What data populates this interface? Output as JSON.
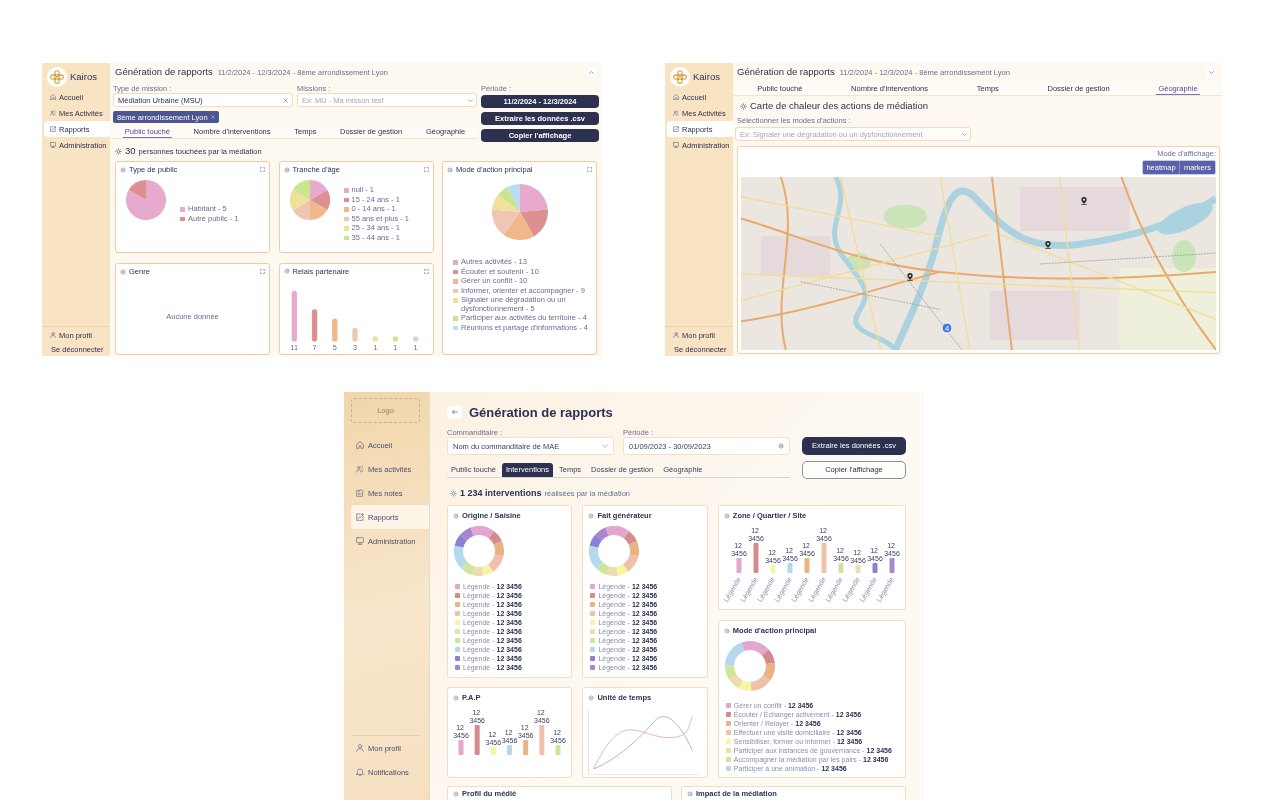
{
  "report_public": {
    "sidebar": {
      "brand": "Kairos",
      "items": [
        {
          "label": "Accueil",
          "selected": false
        },
        {
          "label": "Mes Activités",
          "selected": false
        },
        {
          "label": "Rapports",
          "selected": true
        },
        {
          "label": "Administration",
          "selected": false
        }
      ],
      "footer": [
        "Mon profil",
        "Se déconnecter"
      ]
    },
    "header": {
      "title": "Génération de rapports",
      "subtitle": "11/2/2024 - 12/3/2024 - 8ème arrondissement Lyon",
      "expanded": true
    },
    "filters": {
      "mission_type": {
        "label": "Type de mission :",
        "value": "Médiation Urbaine (MSU)"
      },
      "missions": {
        "label": "Missions :",
        "placeholder": "Ex: MU - Ma misson test"
      },
      "chips": [
        "8ème arrondissement Lyon"
      ],
      "period": {
        "label": "Période :",
        "value": "11/2/2024 - 12/3/2024"
      },
      "buttons": [
        "Extraire les données .csv",
        "Copier l'affichage"
      ]
    },
    "tabs": [
      {
        "label": "Public touché",
        "selected": true
      },
      {
        "label": "Nombre d'interventions",
        "selected": false
      },
      {
        "label": "Temps",
        "selected": false
      },
      {
        "label": "Dossier de gestion",
        "selected": false
      },
      {
        "label": "Géographie",
        "selected": false
      }
    ],
    "summary": {
      "count": "30",
      "text": "personnes touchées par la médiation"
    },
    "cards": [
      {
        "kind": "pie",
        "title": "Type de public",
        "chart_data": {
          "type": "pie",
          "categories": [
            "Habitant - 5",
            "Autre public - 1"
          ],
          "values": [
            83.33,
            16.67
          ],
          "legend": "right",
          "colors": [
            "#e8a9cf",
            "#dc9090"
          ]
        }
      },
      {
        "kind": "pie",
        "title": "Tranche d'âge",
        "chart_data": {
          "type": "pie",
          "categories": [
            "null - 1",
            "15 - 24 ans - 1",
            "0 - 14 ans - 1",
            "55 ans et plus - 1",
            "25 - 34 ans - 1",
            "35 - 44 ans - 1"
          ],
          "values": [
            16.67,
            16.67,
            16.67,
            16.67,
            16.66,
            16.66
          ],
          "legend": "right",
          "colors": [
            "#e8a9cf",
            "#dc9090",
            "#eeb88a",
            "#efc6b6",
            "#efe09a",
            "#cbe48e"
          ]
        }
      },
      {
        "kind": "pie_tall",
        "title": "Mode d'action principal",
        "chart_data": {
          "type": "pie",
          "categories": [
            "Autres activités - 13",
            "Écouter et soutenir - 10",
            "Gérer un conflit - 10",
            "Informer, orienter et accompagner - 9",
            "Signaler une dégradation ou un dysfonctionnement - 5",
            "Participer aux activités du territoire - 4",
            "Réunions et partage d'informations - 4"
          ],
          "values": [
            23.64,
            18.19,
            18.18,
            16.36,
            9.09,
            7.27,
            7.27
          ],
          "legend": "bottom",
          "colors": [
            "#e8a9cf",
            "#dc9090",
            "#eeb88a",
            "#efc6b6",
            "#efe09a",
            "#cbe48e",
            "#b9dcf0"
          ]
        }
      },
      {
        "kind": "empty",
        "title": "Genre",
        "empty_text": "Aucune donnée"
      },
      {
        "kind": "bar",
        "title": "Relais partenaire",
        "chart_data": {
          "type": "bar",
          "values": [
            11,
            7,
            5,
            3,
            1,
            1,
            1
          ],
          "data_labels": true,
          "colors": [
            "#e8a9cf",
            "#dc9090",
            "#eeb88a",
            "#efc6b6",
            "#efe09a",
            "#cbe48e",
            "#b9dcf0"
          ]
        }
      }
    ]
  },
  "report_geography": {
    "sidebar": {
      "brand": "Kairos",
      "items": [
        {
          "label": "Accueil",
          "selected": false
        },
        {
          "label": "Mes Activités",
          "selected": false
        },
        {
          "label": "Rapports",
          "selected": true
        },
        {
          "label": "Administration",
          "selected": false
        }
      ],
      "footer": [
        "Mon profil",
        "Se déconnecter"
      ]
    },
    "header": {
      "title": "Génération de rapports",
      "subtitle": "11/2/2024 - 12/3/2024 - 8ème arrondissement Lyon",
      "expanded": false
    },
    "tabs": [
      {
        "label": "Public touché",
        "selected": false
      },
      {
        "label": "Nombre d'interventions",
        "selected": false
      },
      {
        "label": "Temps",
        "selected": false
      },
      {
        "label": "Dossier de gestion",
        "selected": false
      },
      {
        "label": "Géographie",
        "selected": true
      }
    ],
    "section_title": "Carte de chaleur des actions de médiation",
    "action_filter": {
      "label": "Sélectionner les modes d'actions :",
      "placeholder": "Ex: Signaler une dégradation ou un dysfonctionnement"
    },
    "map": {
      "display_label": "Mode d'affichage:",
      "modes": [
        "heatmap",
        "markers"
      ],
      "markers": [
        {
          "kind": "pin"
        },
        {
          "kind": "pin"
        },
        {
          "kind": "pin"
        },
        {
          "kind": "cluster",
          "count": "4"
        }
      ]
    }
  },
  "report_mockup": {
    "sidebar": {
      "logo_placeholder": "Logo",
      "items": [
        {
          "label": "Accueil",
          "selected": false
        },
        {
          "label": "Mes activités",
          "selected": false
        },
        {
          "label": "Mes notes",
          "selected": false
        },
        {
          "label": "Rapports",
          "selected": true
        },
        {
          "label": "Administration",
          "selected": false
        }
      ],
      "footer": [
        "Mon profil",
        "Notifications"
      ]
    },
    "header": {
      "title": "Génération de rapports"
    },
    "filters": {
      "sponsor": {
        "label": "Commanditaire :",
        "value": "Nom du commanditaire de MAE"
      },
      "period": {
        "label": "Période :",
        "value": "01/09/2023 - 30/09/2023"
      },
      "buttons": [
        {
          "kind": "primary",
          "label": "Extraire les données .csv"
        },
        {
          "kind": "outline",
          "label": "Copier l'affichage"
        }
      ]
    },
    "tabs": [
      {
        "label": "Public touché",
        "selected": false
      },
      {
        "label": "Interventions",
        "selected": true
      },
      {
        "label": "Temps",
        "selected": false
      },
      {
        "label": "Dossier de gestion",
        "selected": false
      },
      {
        "label": "Géographie",
        "selected": false
      }
    ],
    "summary": {
      "count": "1 234 interventions",
      "text": "réalisées par la médiation"
    },
    "card_columns": [
      [
        {
          "kind": "donut",
          "title": "Origine / Saisine",
          "legend": [
            {
              "label": "Légende - **12 3456**",
              "color": "#e2a6cf"
            },
            {
              "label": "Légende - **12 3456**",
              "color": "#d38b8b"
            },
            {
              "label": "Légende - **12 3456**",
              "color": "#e9b383"
            },
            {
              "label": "Légende - **12 3456**",
              "color": "#efc1aa"
            },
            {
              "label": "Légende - **12 3456**",
              "color": "#f8f5a2"
            },
            {
              "label": "Légende - **12 3456**",
              "color": "#ecdcae"
            },
            {
              "label": "Légende - **12 3456**",
              "color": "#cfe59c"
            },
            {
              "label": "Légende - **12 3456**",
              "color": "#b4d9ee"
            },
            {
              "label": "Légende - **12 3456**",
              "color": "#8b80d8"
            },
            {
              "label": "Légende - **12 3456**",
              "color": "#a985d2"
            }
          ]
        },
        {
          "kind": "bar",
          "title": "P.A.P",
          "bars": [
            {
              "label": "12 3456",
              "color": "#e2a6cf"
            },
            {
              "label": "12 3456",
              "color": "#d38b8b"
            },
            {
              "label": "12 3456",
              "color": "#f8f5a2"
            },
            {
              "label": "12 3456",
              "color": "#b4d9ee"
            },
            {
              "label": "12 3456",
              "color": "#e9b383"
            },
            {
              "label": "12 3456",
              "color": "#efc1aa"
            },
            {
              "label": "12 3456",
              "color": "#cfe59c"
            }
          ]
        }
      ],
      [
        {
          "kind": "donut",
          "title": "Fait générateur",
          "legend": [
            {
              "label": "Légende - **12 3456**",
              "color": "#e2a6cf"
            },
            {
              "label": "Légende - **12 3456**",
              "color": "#d38b8b"
            },
            {
              "label": "Légende - **12 3456**",
              "color": "#e9b383"
            },
            {
              "label": "Légende - **12 3456**",
              "color": "#efc1aa"
            },
            {
              "label": "Légende - **12 3456**",
              "color": "#f8f5a2"
            },
            {
              "label": "Légende - **12 3456**",
              "color": "#ecdcae"
            },
            {
              "label": "Légende - **12 3456**",
              "color": "#cfe59c"
            },
            {
              "label": "Légende - **12 3456**",
              "color": "#b4d9ee"
            },
            {
              "label": "Légende - **12 3456**",
              "color": "#8b80d8"
            },
            {
              "label": "Légende - **12 3456**",
              "color": "#a985d2"
            }
          ]
        },
        {
          "kind": "line",
          "title": "Unité de temps"
        }
      ],
      [
        {
          "kind": "bar",
          "title": "Zone / Quartier / Site",
          "bars": [
            {
              "label": "12 3456",
              "category": "Légende",
              "color": "#e2a6cf"
            },
            {
              "label": "12 3456",
              "category": "Légende",
              "color": "#d38b8b"
            },
            {
              "label": "12 3456",
              "category": "Légende",
              "color": "#f8f5a2"
            },
            {
              "label": "12 3456",
              "category": "Légende",
              "color": "#b4d9ee"
            },
            {
              "label": "12 3456",
              "category": "Légende",
              "color": "#e9b383"
            },
            {
              "label": "12 3456",
              "category": "Légende",
              "color": "#efc1aa"
            },
            {
              "label": "12 3456",
              "category": "Légende",
              "color": "#cfe59c"
            },
            {
              "label": "12 3456",
              "category": "Légende",
              "color": "#ecdcae"
            },
            {
              "label": "12 3456",
              "category": "Légende",
              "color": "#8b80d8"
            },
            {
              "label": "12 3456",
              "category": "Légende",
              "color": "#a985d2"
            }
          ]
        },
        {
          "kind": "donut",
          "title": "Mode d'action principal",
          "legend": [
            {
              "label": "Gérer un conflit - **12 3456**",
              "color": "#e2a6cf"
            },
            {
              "label": "Écouter / Échanger activement - **12 3456**",
              "color": "#d38b8b"
            },
            {
              "label": "Orienter / Relayer - **12 3456**",
              "color": "#e9b383"
            },
            {
              "label": "Effectuer une visite domiciliaire - **12 3456**",
              "color": "#efc1aa"
            },
            {
              "label": "Sensibiliser, former ou informer - **12 3456**",
              "color": "#f8f5a2"
            },
            {
              "label": "Participer aux instances de gouvernance - **12 3456**",
              "color": "#ecdcae"
            },
            {
              "label": "Accompagner la médiation par les pairs - **12 3456**",
              "color": "#cfe59c"
            },
            {
              "label": "Participer à une animation - **12 3456**",
              "color": "#b4d9ee"
            }
          ]
        }
      ]
    ],
    "bottom_cards": [
      {
        "title": "Profil du médié"
      },
      {
        "title": "Impact de la médiation"
      }
    ]
  }
}
